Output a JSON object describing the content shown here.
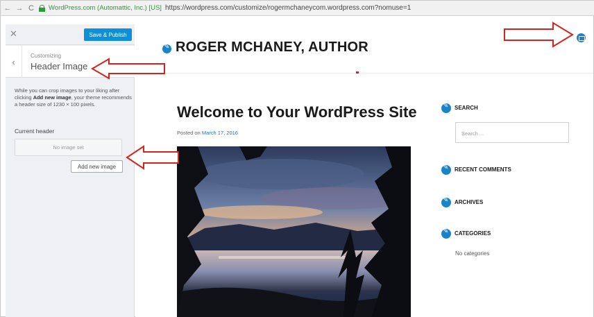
{
  "browser": {
    "back": "←",
    "forward": "→",
    "reload": "C",
    "secure_label": "WordPress.com (Automattic, Inc.) [US]",
    "url": "https://wordpress.com/customize/rogermchaneycom.wordpress.com?nomuse=1"
  },
  "customizer": {
    "close_icon": "✕",
    "save_label": "Save & Publish",
    "back_icon": "‹",
    "customizing_label": "Customizing",
    "section_title": "Header Image",
    "help_text_before": "While you can crop images to your liking after clicking ",
    "help_text_bold": "Add new image",
    "help_text_after": ", your theme recommends a header size of 1230 × 100 pixels.",
    "current_header_label": "Current header",
    "no_image_text": "No image set",
    "add_image_label": "Add new image"
  },
  "preview": {
    "site_title": "ROGER MCHANEY, AUTHOR",
    "post_title": "Welcome to Your WordPress Site",
    "posted_on_label": "Posted on ",
    "post_date": "March 17, 2016",
    "widgets": {
      "search_title": "SEARCH",
      "search_placeholder": "Search ...",
      "recent_comments_title": "RECENT COMMENTS",
      "archives_title": "ARCHIVES",
      "categories_title": "CATEGORIES",
      "no_categories": "No categories"
    }
  },
  "colors": {
    "accent": "#1785c8",
    "button": "#0f8fd6",
    "annotation": "#d9221e"
  }
}
